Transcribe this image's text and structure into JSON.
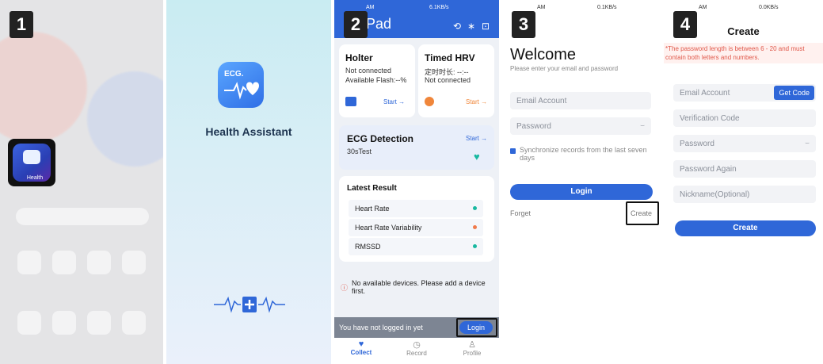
{
  "steps": [
    "1",
    "2",
    "3",
    "4"
  ],
  "panel1": {
    "app_label": "Health"
  },
  "panel2": {
    "app_title": "Health Assistant",
    "logo_text": "ECG."
  },
  "panel3": {
    "status_time": "AM",
    "status_right": "6.1KB/s",
    "header_title": "Pad",
    "holter": {
      "title": "Holter",
      "status": "Not connected",
      "flash": "Available Flash:--%",
      "start": "Start"
    },
    "timed_hrv": {
      "title": "Timed HRV",
      "timer": "定时时长: --:--",
      "status": "Not connected",
      "start": "Start"
    },
    "ecg": {
      "title": "ECG Detection",
      "sub": "30sTest",
      "start": "Start"
    },
    "latest": {
      "title": "Latest Result",
      "rows": [
        "Heart Rate",
        "Heart Rate Variability",
        "RMSSD"
      ]
    },
    "no_devices": "No available devices. Please add a device first.",
    "login_bar": {
      "text": "You have not logged in yet",
      "button": "Login"
    },
    "nav": [
      {
        "label": "Collect",
        "icon": "heart-icon"
      },
      {
        "label": "Record",
        "icon": "clock-icon"
      },
      {
        "label": "Profile",
        "icon": "person-icon"
      }
    ],
    "colors": {
      "accent": "#2f67d8",
      "dot_green": "#18b8a0",
      "dot_orange": "#f07a4a",
      "timer_orange": "#f0863a"
    }
  },
  "panel4": {
    "status_time": "AM",
    "status_right": "0.1KB/s",
    "title": "Welcome",
    "subtitle": "Please enter your email and password",
    "email_placeholder": "Email Account",
    "password_placeholder": "Password",
    "sync_label": "Synchronize records from the last seven days",
    "login_button": "Login",
    "forget": "Forget",
    "create": "Create"
  },
  "panel5": {
    "status_time": "AM",
    "status_right": "0.0KB/s",
    "title": "Create",
    "warning": "*The password length is between 6 - 20 and must contain both letters and numbers.",
    "email_placeholder": "Email Account",
    "get_code": "Get Code",
    "verification_placeholder": "Verification Code",
    "password_placeholder": "Password",
    "password_again_placeholder": "Password Again",
    "nickname_placeholder": "Nickname(Optional)",
    "create_button": "Create",
    "colors": {
      "warning": "#e0584a"
    }
  }
}
